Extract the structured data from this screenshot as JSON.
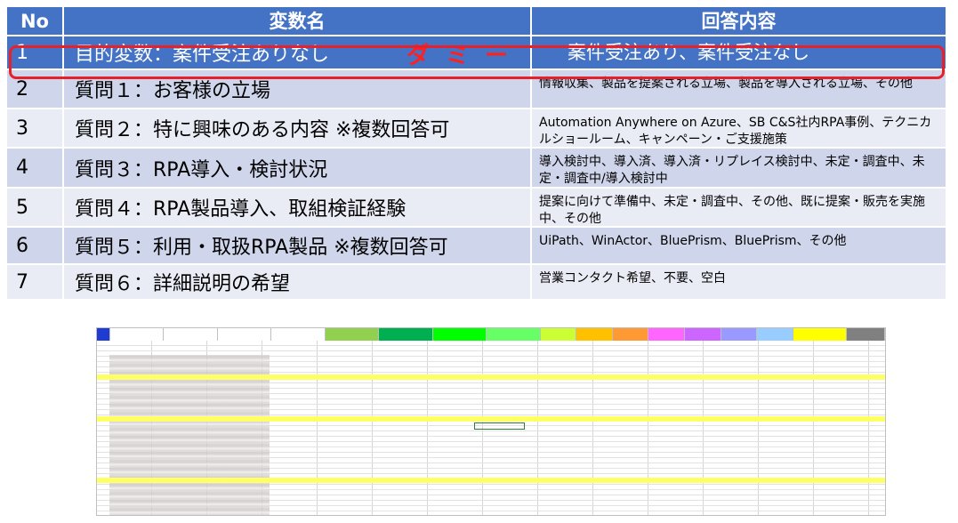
{
  "table": {
    "headers": {
      "no": "No",
      "variable": "変数名",
      "answer": "回答内容"
    },
    "dummy_label": "ダミー",
    "rows": [
      {
        "no": "1",
        "variable": "目的変数：案件受注ありなし",
        "answer": "案件受注あり、案件受注なし",
        "highlighted": true
      },
      {
        "no": "2",
        "variable": "質問１：お客様の立場",
        "answer": "情報収集、製品を提案される立場、製品を導入される立場、その他"
      },
      {
        "no": "3",
        "variable": "質問２：特に興味のある内容 ※複数回答可",
        "answer": "Automation Anywhere on Azure、SB C&S社内RPA事例、テクニカルショールーム、キャンペーン・ご支援施策"
      },
      {
        "no": "4",
        "variable": "質問３：RPA導入・検討状況",
        "answer": "導入検討中、導入済、導入済・リプレイス検討中、未定・調査中、未定・調査中/導入検討中"
      },
      {
        "no": "5",
        "variable": "質問４：RPA製品導入、取組検証経験",
        "answer": "提案に向けて準備中、未定・調査中、その他、既に提案・販売を実施中、その他"
      },
      {
        "no": "6",
        "variable": "質問５：利用・取扱RPA製品 ※複数回答可",
        "answer": "UiPath、WinActor、BluePrism、BluePrism、その他"
      },
      {
        "no": "7",
        "variable": "質問６：詳細説明の希望",
        "answer": "営業コンタクト希望、不要、空白"
      }
    ]
  },
  "spreadsheet": {
    "header_colors": [
      "#1f3cd2",
      "#ffffff",
      "#ffffff",
      "#ffffff",
      "#ffffff",
      "#92d050",
      "#00b050",
      "#00ff00",
      "#66ff66",
      "#ccff33",
      "#ffc000",
      "#ff9933",
      "#ff66ff",
      "#cc66ff",
      "#9999ff",
      "#99ccff",
      "#ffff00",
      "#808080"
    ],
    "highlight_color": "#ffff66"
  }
}
